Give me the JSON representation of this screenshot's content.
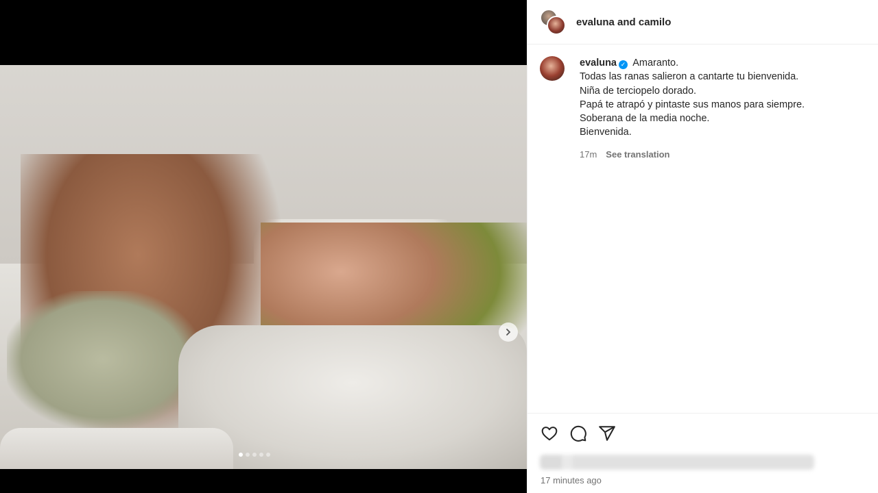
{
  "post": {
    "header_title": "evaluna and camilo",
    "carousel": {
      "total_slides": 5,
      "current_slide": 1
    }
  },
  "caption": {
    "username": "evaluna",
    "verified": true,
    "lines": [
      "Amaranto.",
      "Todas las ranas salieron a cantarte tu bienvenida.",
      "Niña de terciopelo dorado.",
      "Papá te atrapó y pintaste sus manos para siempre.",
      "Soberana de la media noche.",
      "Bienvenida."
    ],
    "time": "17m",
    "see_translation": "See translation"
  },
  "footer": {
    "timestamp": "17 minutes ago"
  },
  "icons": {
    "like": "heart-icon",
    "comment": "comment-icon",
    "share": "share-icon",
    "next": "chevron-right-icon",
    "verified": "verified-badge-icon"
  },
  "colors": {
    "verified": "#0095f6",
    "text": "#262626",
    "muted": "#737373"
  }
}
